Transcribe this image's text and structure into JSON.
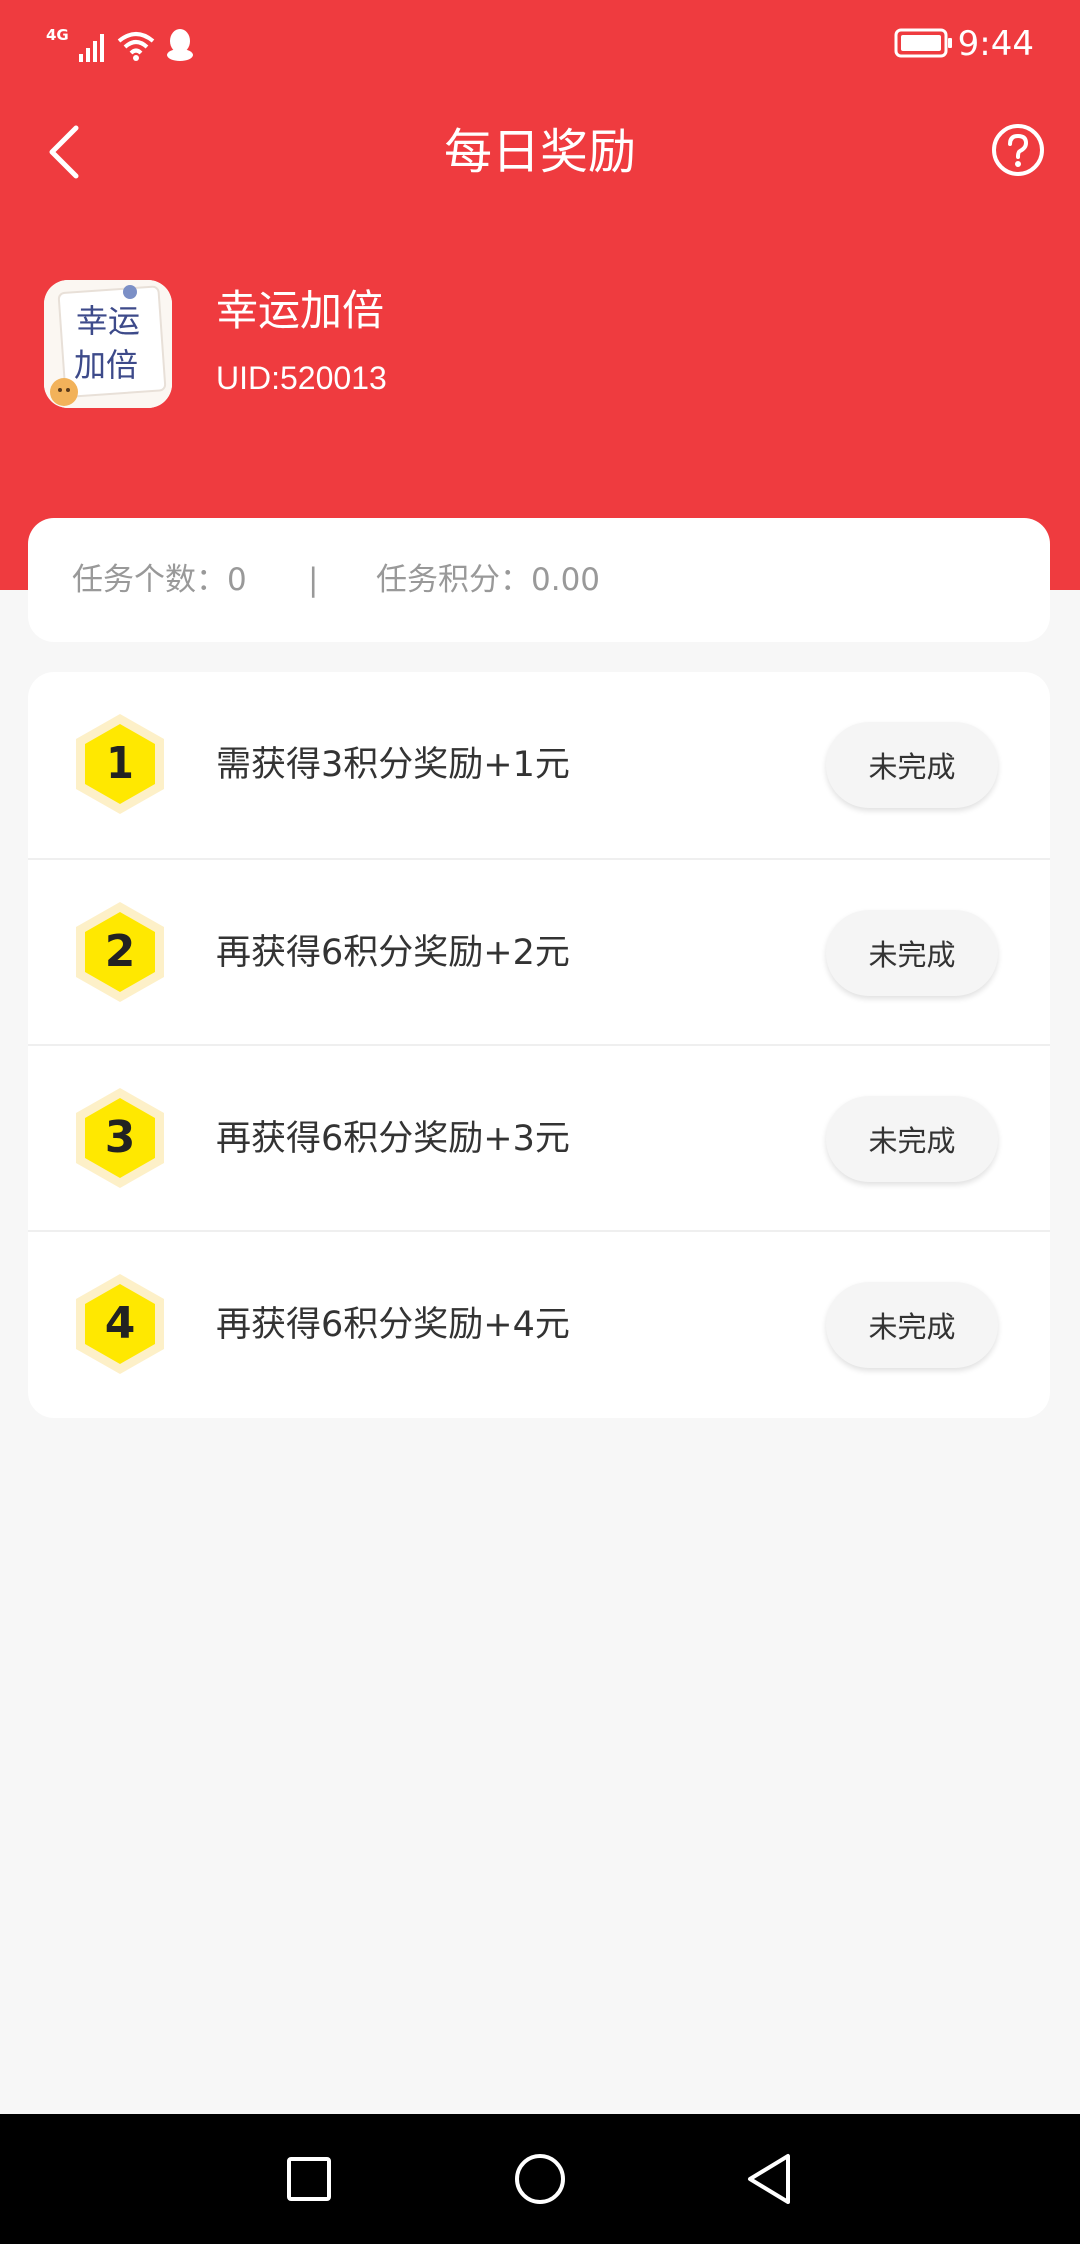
{
  "status_bar": {
    "network": "4G",
    "time": "9:44"
  },
  "nav": {
    "title": "每日奖励",
    "back_icon": "chevron-left-icon",
    "help_icon": "question-circle-icon"
  },
  "profile": {
    "avatar_text": [
      "幸运",
      "加倍"
    ],
    "name": "幸运加倍",
    "uid": "UID:520013"
  },
  "summary": {
    "task_count": "任务个数：0",
    "separator": "|",
    "task_points": "任务积分：0.00"
  },
  "tasks": [
    {
      "number": "1",
      "text": "需获得3积分奖励+1元",
      "status": "未完成"
    },
    {
      "number": "2",
      "text": "再获得6积分奖励+2元",
      "status": "未完成"
    },
    {
      "number": "3",
      "text": "再获得6积分奖励+3元",
      "status": "未完成"
    },
    {
      "number": "4",
      "text": "再获得6积分奖励+4元",
      "status": "未完成"
    }
  ],
  "colors": {
    "header": "#ef3b3f",
    "badge_fill": "#ffe800",
    "badge_ring": "#fdf0c8"
  }
}
